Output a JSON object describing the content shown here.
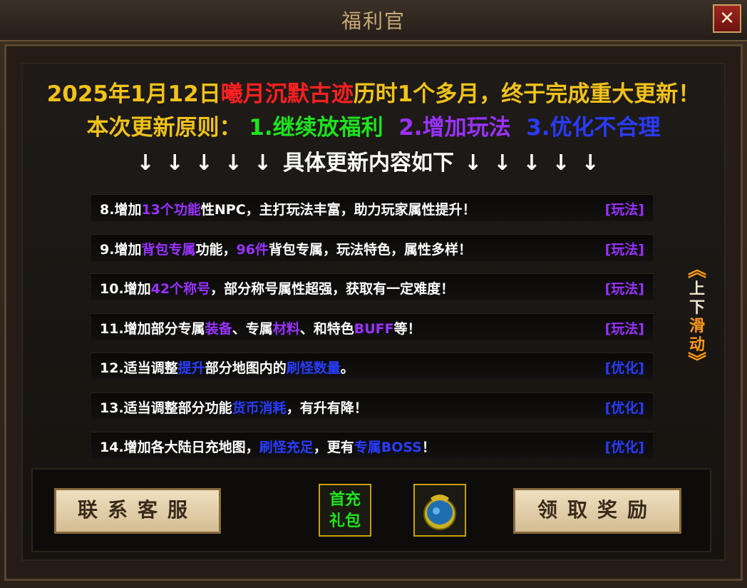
{
  "window": {
    "title": "福利官",
    "close_label": "✕"
  },
  "headline": {
    "line1_pre": "2025年1月12日",
    "line1_red": "曦月沉默古迹",
    "line1_post": "历时1个多月，终于完成重大更新！",
    "line2_pre": "本次更新原则：",
    "line2_green": "1.继续放福利",
    "line2_purple": "2.增加玩法",
    "line2_blue": "3.优化不合理",
    "line3_arrows_left": "↓↓↓↓↓",
    "line3_text": "具体更新内容如下",
    "line3_arrows_right": "↓↓↓↓↓"
  },
  "updates": [
    {
      "parts": [
        [
          "8.增加",
          ""
        ],
        [
          "13个功能",
          "p"
        ],
        [
          "性NPC，主打玩法丰富，助力玩家属性提升！",
          ""
        ]
      ],
      "tag": "[玩法]",
      "kind": "play"
    },
    {
      "parts": [
        [
          "9.增加",
          ""
        ],
        [
          "背包专属",
          "p"
        ],
        [
          "功能，",
          ""
        ],
        [
          "96件",
          "p"
        ],
        [
          "背包专属，玩法特色，属性多样！",
          ""
        ]
      ],
      "tag": "[玩法]",
      "kind": "play"
    },
    {
      "parts": [
        [
          "10.增加",
          ""
        ],
        [
          "42个称号",
          "p"
        ],
        [
          "，部分称号属性超强，获取有一定难度！",
          ""
        ]
      ],
      "tag": "[玩法]",
      "kind": "play"
    },
    {
      "parts": [
        [
          "11.增加部分专属",
          ""
        ],
        [
          "装备",
          "p"
        ],
        [
          "、专属",
          ""
        ],
        [
          "材料",
          "p"
        ],
        [
          "、和特色",
          ""
        ],
        [
          "BUFF",
          "p"
        ],
        [
          "等！",
          ""
        ]
      ],
      "tag": "[玩法]",
      "kind": "play"
    },
    {
      "parts": [
        [
          "12.适当调整",
          ""
        ],
        [
          "提升",
          "b"
        ],
        [
          "部分地图内的",
          ""
        ],
        [
          "刷怪数量",
          "b"
        ],
        [
          "。",
          ""
        ]
      ],
      "tag": "[优化]",
      "kind": "opt"
    },
    {
      "parts": [
        [
          "13.适当调整部分功能",
          ""
        ],
        [
          "货币消耗",
          "b"
        ],
        [
          "，有升有降！",
          ""
        ]
      ],
      "tag": "[优化]",
      "kind": "opt"
    },
    {
      "parts": [
        [
          "14.增加各大陆日充地图，",
          ""
        ],
        [
          "刷怪充足",
          "b"
        ],
        [
          "，更有",
          ""
        ],
        [
          "专属BOSS",
          "b"
        ],
        [
          "！",
          ""
        ]
      ],
      "tag": "[优化]",
      "kind": "opt"
    }
  ],
  "scroll_hint": {
    "top": "上",
    "mid": "下",
    "bottom1": "滑",
    "bottom2": "动"
  },
  "buttons": {
    "service": "联系客服",
    "claim": "领取奖励"
  },
  "icons": {
    "recharge_line1": "首充",
    "recharge_line2": "礼包",
    "bag": "gift-bag-icon"
  },
  "colors": {
    "yellow": "#f1c21a",
    "red": "#ff2020",
    "green": "#1ee31e",
    "purple": "#9a32ff",
    "blue": "#2a3cff"
  }
}
